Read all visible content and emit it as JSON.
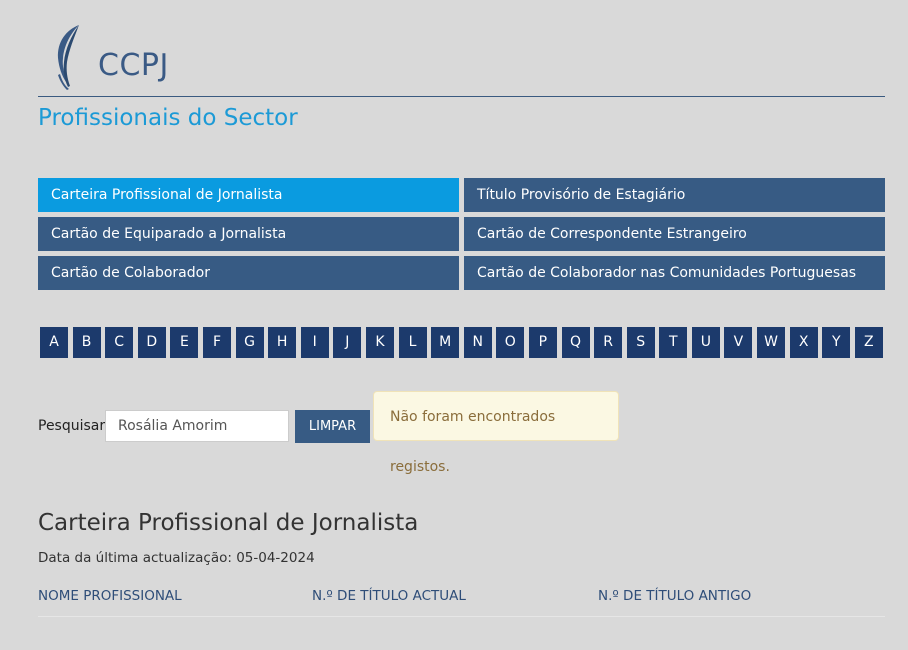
{
  "brand": {
    "name": "CCPJ",
    "logo_icon": "feather-icon",
    "accent": "#3a5a85"
  },
  "page_title": "Profissionais do Sector",
  "categories": [
    {
      "label": "Carteira Profissional de Jornalista",
      "active": true
    },
    {
      "label": "Título Provisório de Estagiário",
      "active": false
    },
    {
      "label": "Cartão de Equiparado a Jornalista",
      "active": false
    },
    {
      "label": "Cartão de Correspondente Estrangeiro",
      "active": false
    },
    {
      "label": "Cartão de Colaborador",
      "active": false
    },
    {
      "label": "Cartão de Colaborador nas Comunidades Portuguesas",
      "active": false
    }
  ],
  "alphabet": [
    "A",
    "B",
    "C",
    "D",
    "E",
    "F",
    "G",
    "H",
    "I",
    "J",
    "K",
    "L",
    "M",
    "N",
    "O",
    "P",
    "Q",
    "R",
    "S",
    "T",
    "U",
    "V",
    "W",
    "X",
    "Y",
    "Z"
  ],
  "search": {
    "label": "Pesquisar",
    "value": "Rosália Amorim",
    "clear_label": "LIMPAR"
  },
  "alert": {
    "message": "Não foram encontrados registos."
  },
  "section": {
    "title": "Carteira Profissional de Jornalista",
    "update_label": "Data da última actualização:",
    "update_date": "05-04-2024"
  },
  "table": {
    "columns": [
      "NOME PROFISSIONAL",
      "N.º DE TÍTULO ACTUAL",
      "N.º DE TÍTULO ANTIGO"
    ]
  },
  "colors": {
    "active_tab": "#0a9be0",
    "tab": "#375b84",
    "letter_button": "#1c3a6c",
    "alert_bg": "#fbf8e3",
    "title_blue": "#1c9ad6"
  }
}
